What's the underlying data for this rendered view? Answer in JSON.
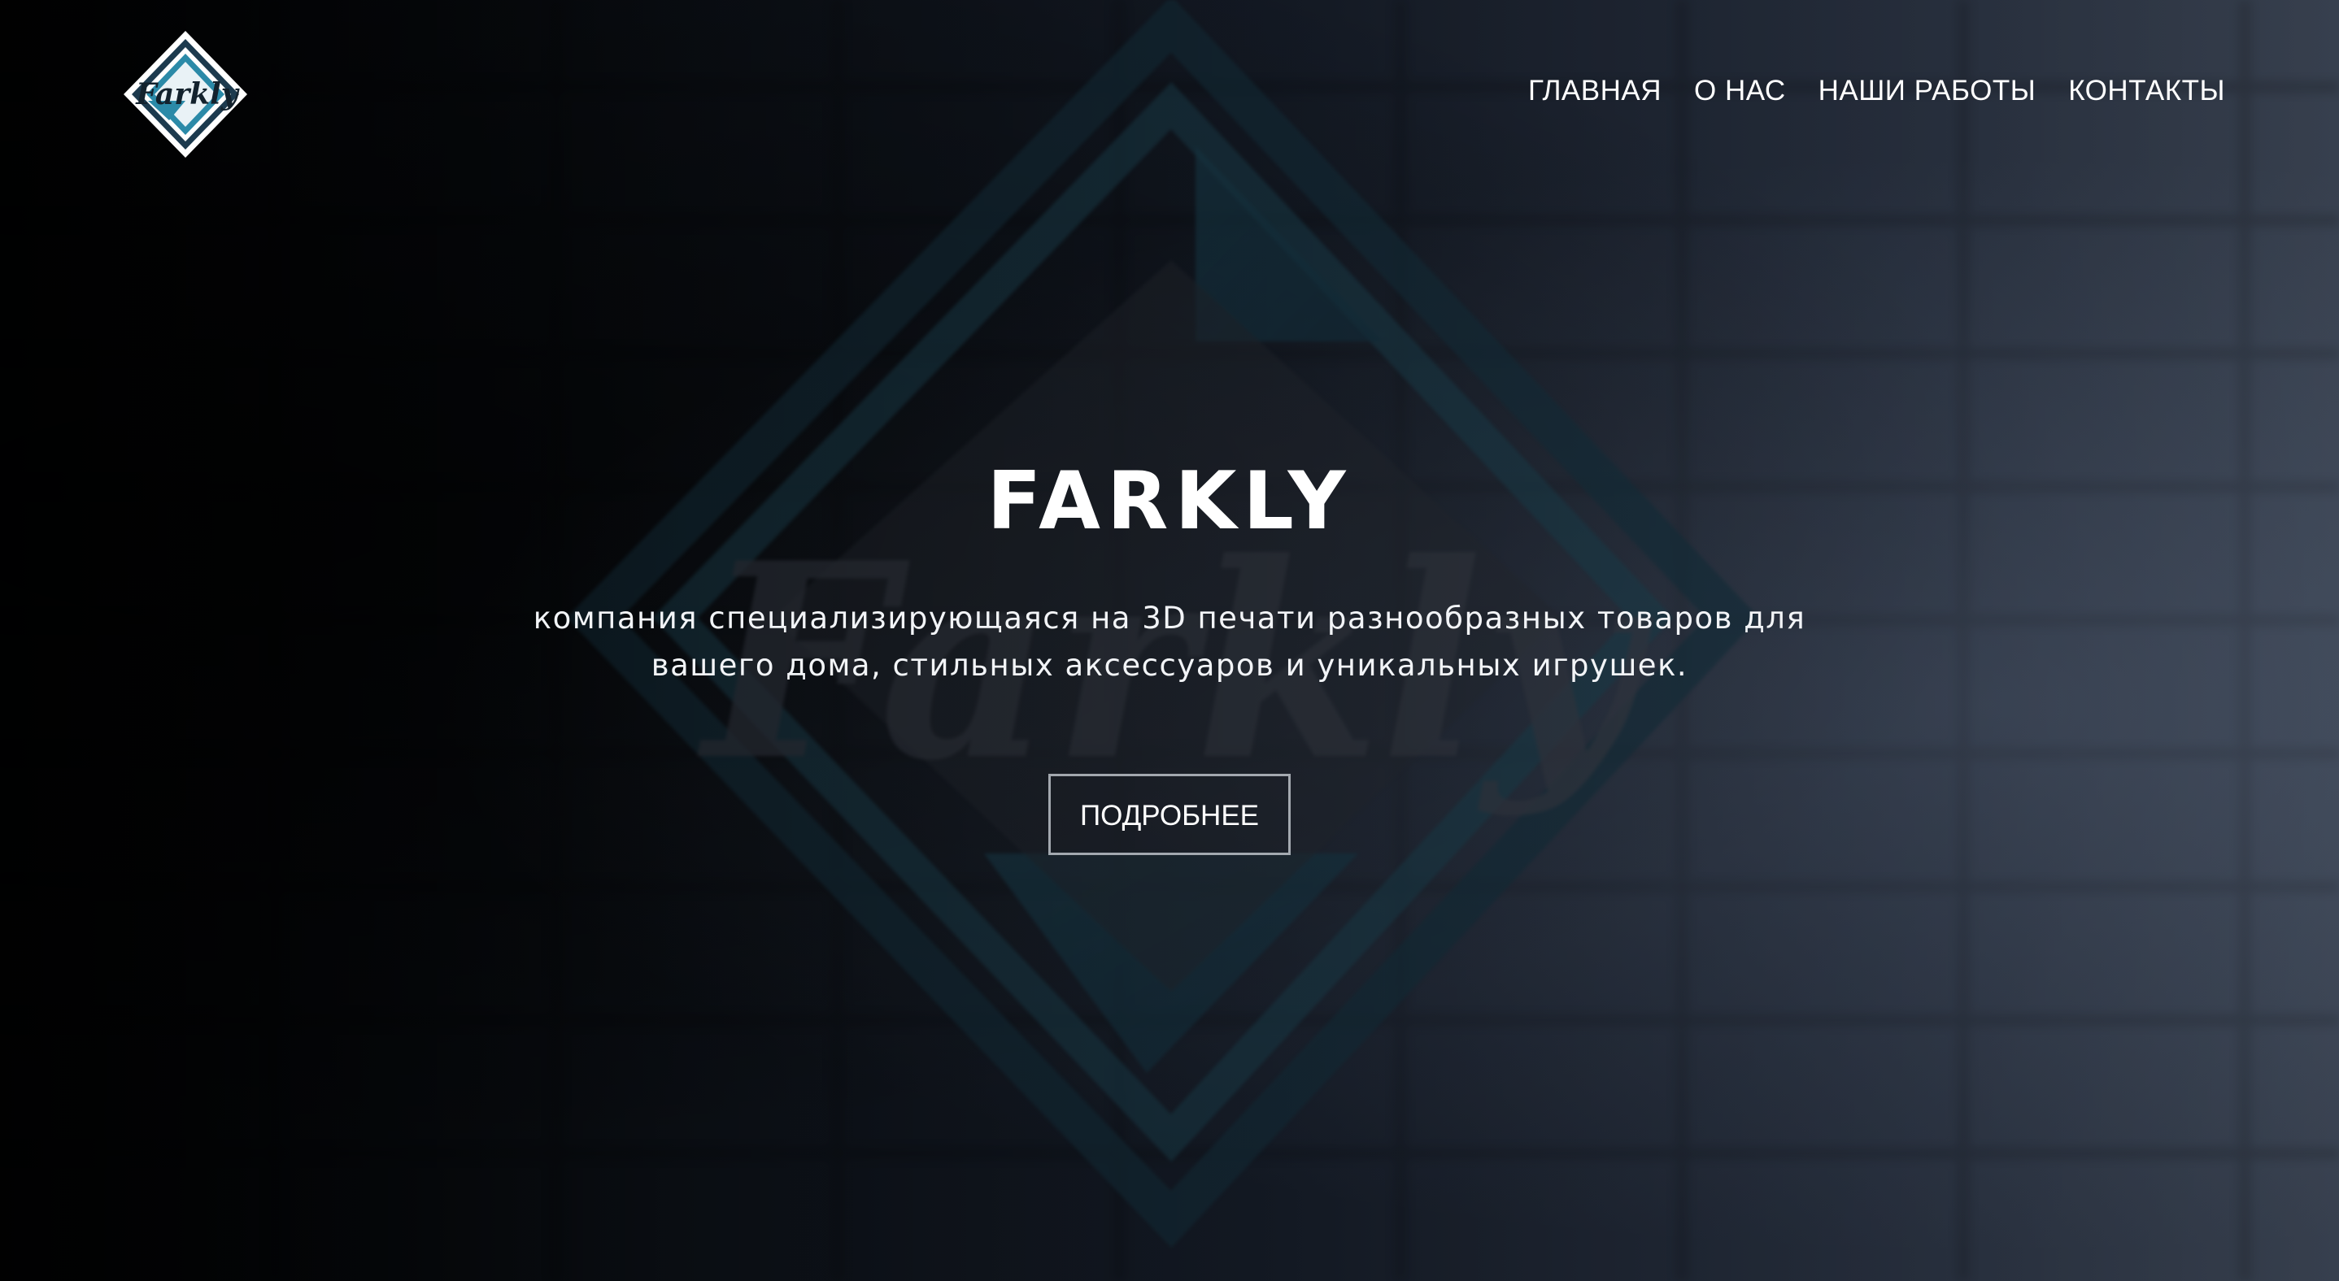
{
  "brand": {
    "logo_text": "Farkly",
    "accent_color": "#2b8aa8",
    "logo_frame_color": "#1c3a4e"
  },
  "nav": {
    "items": [
      {
        "label": "ГЛАВНАЯ"
      },
      {
        "label": "О НАС"
      },
      {
        "label": "НАШИ РАБОТЫ"
      },
      {
        "label": "КОНТАКТЫ"
      }
    ]
  },
  "hero": {
    "title": "FARKLY",
    "description": "компания специализирующаяся на 3D печати разнообразных товаров для вашего дома, стильных аксессуаров и уникальных игрушек.",
    "button_label": "ПОДРОБНЕЕ"
  },
  "background": {
    "image": "blurred 3D Farkly logo on dark brick wall",
    "icon": "farkly-logo-3d"
  }
}
